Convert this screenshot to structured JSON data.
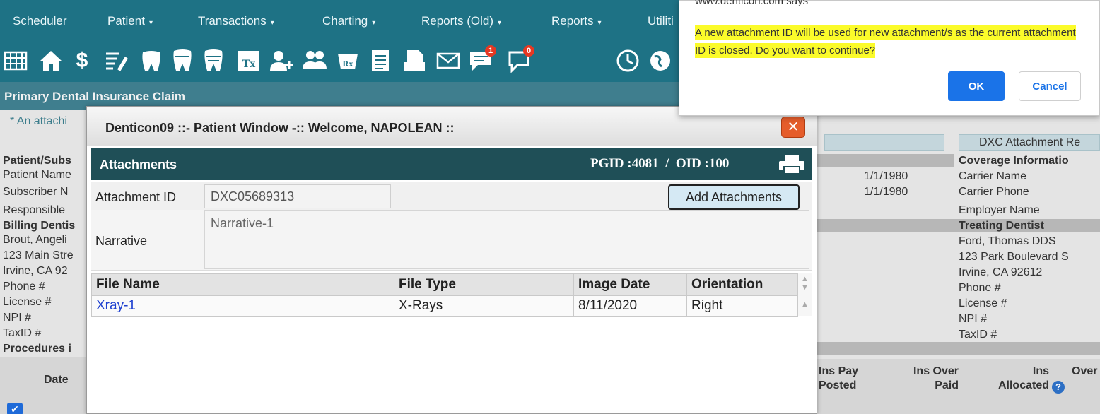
{
  "nav": {
    "items": [
      {
        "label": "Scheduler",
        "caret": ""
      },
      {
        "label": "Patient",
        "caret": "▾"
      },
      {
        "label": "Transactions",
        "caret": "▾"
      },
      {
        "label": "Charting",
        "caret": "▾"
      },
      {
        "label": "Reports (Old)",
        "caret": "▾"
      },
      {
        "label": "Reports",
        "caret": "▾"
      },
      {
        "label": "Utiliti",
        "caret": ""
      }
    ]
  },
  "toolbar": {
    "icons": [
      "calendar-grid-icon",
      "home-icon",
      "ledger-money-icon",
      "notes-edit-icon",
      "tooth-icon",
      "tooth-chart-icon",
      "treatment-plan-icon",
      "add-patient-icon",
      "add-family-icon",
      "prescription-icon",
      "document-list-icon",
      "printer-form-icon",
      "envelope-icon",
      "message-icon",
      "chat-icon",
      "clock-icon",
      "globe-icon"
    ],
    "message_badge": "1",
    "chat_badge": "0"
  },
  "page": {
    "title": "Primary Dental Insurance Claim",
    "notice": "* An attachi",
    "left_labels": [
      {
        "text": "Patient/Subs",
        "bold": true
      },
      {
        "text": "Patient Name",
        "bold": false
      },
      {
        "text": "Subscriber N",
        "bold": false
      },
      {
        "text": "Responsible",
        "bold": false
      },
      {
        "text": "Billing Dentis",
        "bold": true
      },
      {
        "text": "Brout, Angeli",
        "bold": false
      },
      {
        "text": "123 Main Stre",
        "bold": false
      },
      {
        "text": "Irvine, CA 92",
        "bold": false
      },
      {
        "text": "Phone #",
        "bold": false
      },
      {
        "text": "License #",
        "bold": false
      },
      {
        "text": "NPI #",
        "bold": false
      },
      {
        "text": "TaxID #",
        "bold": false
      },
      {
        "text": "Procedures i",
        "bold": true
      }
    ],
    "date_col": "Date",
    "dob_1": "1/1/1980",
    "dob_2": "1/1/1980",
    "dxc_attach_btn": "DXC Attachment Re",
    "right_labels": [
      {
        "text": "Coverage Informatio",
        "bold": true
      },
      {
        "text": "Carrier Name",
        "bold": false
      },
      {
        "text": "Carrier Phone",
        "bold": false
      },
      {
        "text": "Employer Name",
        "bold": false
      },
      {
        "text": "Treating Dentist",
        "bold": true
      },
      {
        "text": "Ford, Thomas DDS",
        "bold": false
      },
      {
        "text": "123 Park Boulevard S",
        "bold": false
      },
      {
        "text": "Irvine, CA 92612",
        "bold": false
      },
      {
        "text": "Phone #",
        "bold": false
      },
      {
        "text": "License #",
        "bold": false
      },
      {
        "text": "NPI #",
        "bold": false
      },
      {
        "text": "TaxID #",
        "bold": false
      }
    ],
    "proc_headers": {
      "ins_pay_posted": "Ins Pay\nPosted",
      "ins_over_paid": "Ins Over\nPaid",
      "ins_allocated": "Ins\nAllocated",
      "over": "Over"
    }
  },
  "patient_window": {
    "title": "Denticon09 ::- Patient Window -:: Welcome, NAPOLEAN ::",
    "close_label": "✕",
    "section_title": "Attachments",
    "pgid_oid": "PGID :4081  /  OID :100",
    "attachment_id_label": "Attachment ID",
    "attachment_id_value": "DXC05689313",
    "add_attachments_label": "Add Attachments",
    "narrative_label": "Narrative",
    "narrative_value": "Narrative-1",
    "table": {
      "headers": [
        "File Name",
        "File Type",
        "Image Date",
        "Orientation"
      ],
      "rows": [
        [
          "Xray-1",
          "X-Rays",
          "8/11/2020",
          "Right"
        ]
      ]
    }
  },
  "confirm_dialog": {
    "origin": "www.denticon.com says",
    "message": "A new attachment ID will be used for new attachment/s as the current attachment ID is closed. Do you want to continue?",
    "highlight_color": "#fbfb2a",
    "ok_label": "OK",
    "cancel_label": "Cancel"
  },
  "colors": {
    "nav_bg": "#1e7285",
    "window_header_bg": "#1f4f57",
    "close_btn": "#e55d2b",
    "ok_btn": "#1a73e8",
    "link": "#1d3fd0"
  }
}
